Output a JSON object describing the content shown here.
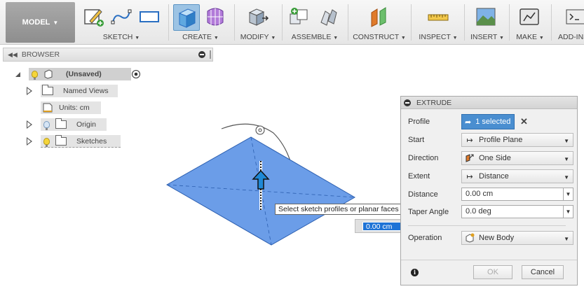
{
  "toolbar": {
    "workspace": "MODEL",
    "groups": {
      "sketch": "SKETCH",
      "create": "CREATE",
      "modify": "MODIFY",
      "assemble": "ASSEMBLE",
      "construct": "CONSTRUCT",
      "inspect": "INSPECT",
      "insert": "INSERT",
      "make": "MAKE",
      "addins": "ADD-INS"
    }
  },
  "browser": {
    "title": "BROWSER",
    "root": "(Unsaved)",
    "items": {
      "named_views": "Named Views",
      "units": "Units: cm",
      "origin": "Origin",
      "sketches": "Sketches"
    }
  },
  "canvas": {
    "tooltip": "Select sketch profiles or planar faces to extrude",
    "distance_input": "0.00 cm"
  },
  "extrude": {
    "title": "EXTRUDE",
    "profile_label": "Profile",
    "profile_value": "1 selected",
    "start_label": "Start",
    "start_value": "Profile Plane",
    "direction_label": "Direction",
    "direction_value": "One Side",
    "extent_label": "Extent",
    "extent_value": "Distance",
    "distance_label": "Distance",
    "distance_value": "0.00 cm",
    "taper_label": "Taper Angle",
    "taper_value": "0.0 deg",
    "operation_label": "Operation",
    "operation_value": "New Body",
    "ok": "OK",
    "cancel": "Cancel"
  },
  "colors": {
    "sketch_fill": "#6b9de8",
    "arrow_accent": "#1e88d6",
    "selection_blue": "#4a8ed0"
  }
}
